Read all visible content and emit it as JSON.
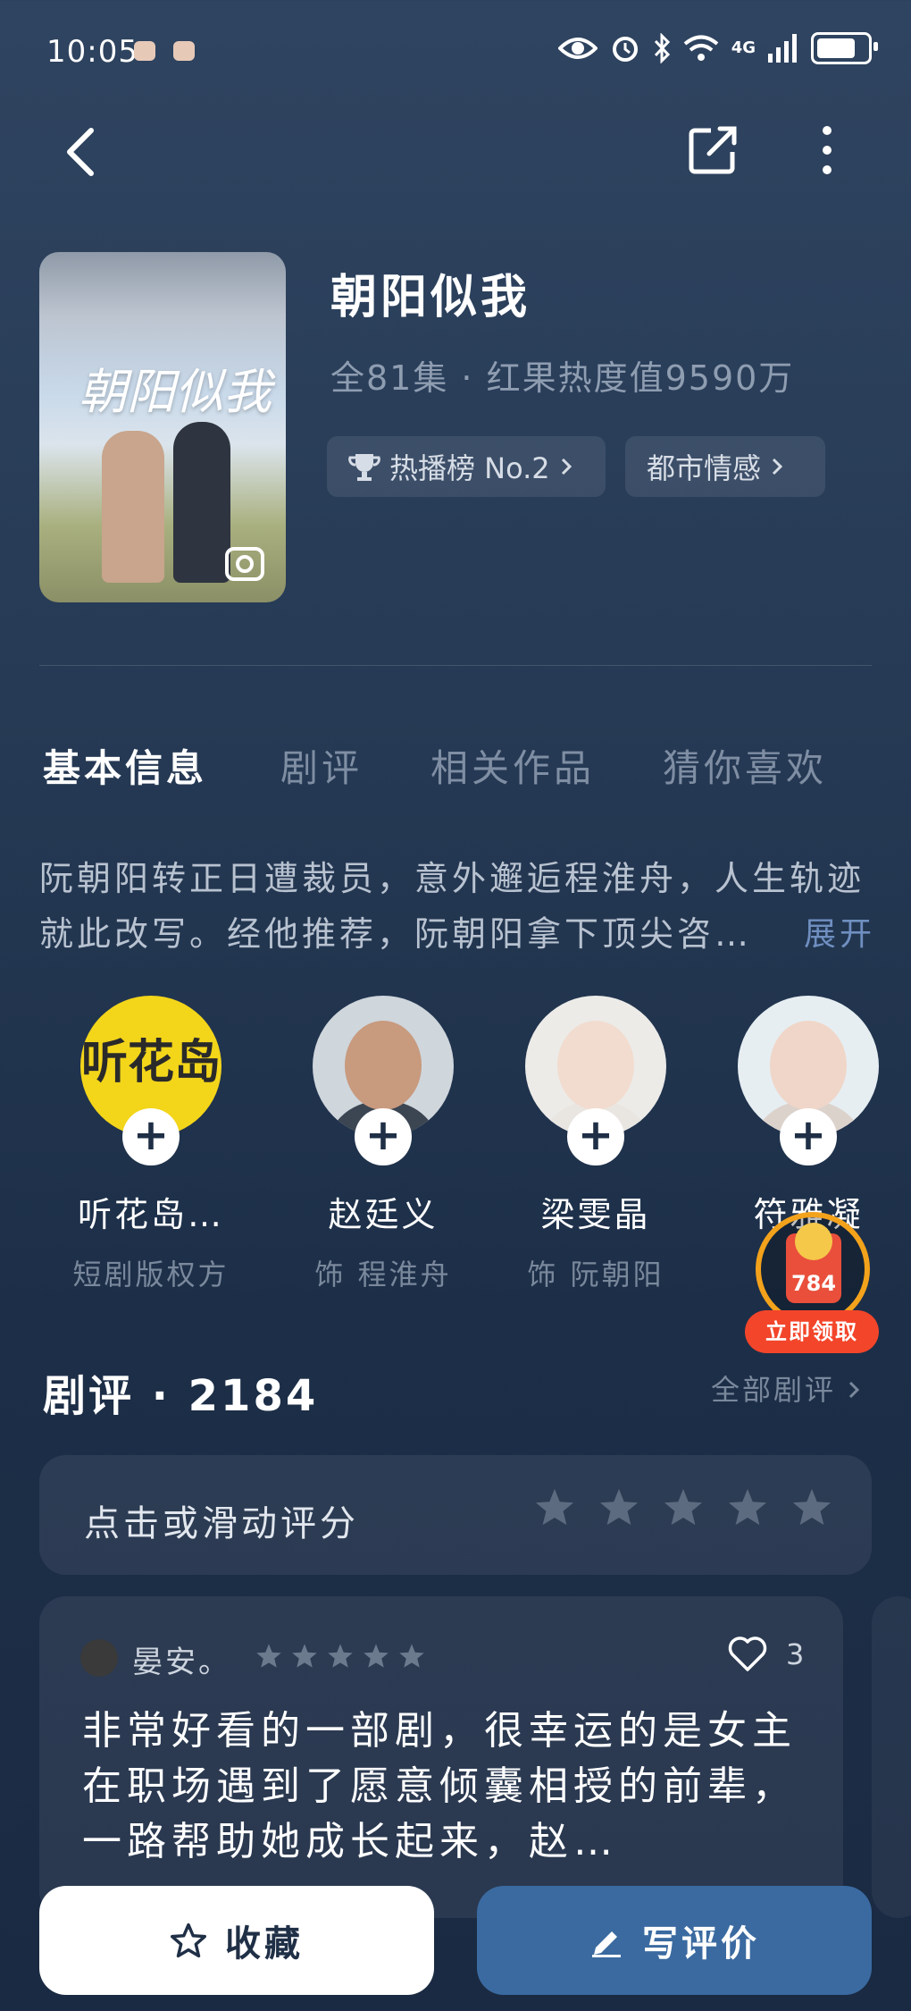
{
  "status_bar": {
    "time": "10:05",
    "network": "4G"
  },
  "show": {
    "title": "朝阳似我",
    "meta": "全81集 · 红果热度值9590万",
    "poster_title": "朝阳似我",
    "tags": [
      {
        "label": "热播榜 No.2",
        "icon": "trophy-icon"
      },
      {
        "label": "都市情感"
      }
    ]
  },
  "tabs": [
    {
      "label": "基本信息",
      "active": true
    },
    {
      "label": "剧评"
    },
    {
      "label": "相关作品"
    },
    {
      "label": "猜你喜欢"
    }
  ],
  "synopsis": {
    "text": "阮朝阳转正日遭裁员，意外邂逅程淮舟，人生轨迹就此改写。经他推荐，阮朝阳拿下顶尖咨…",
    "expand_label": "展开"
  },
  "cast": [
    {
      "name": "听花岛…",
      "role": "短剧版权方",
      "logo_text": "听花岛"
    },
    {
      "name": "赵廷义",
      "role": "饰 程淮舟"
    },
    {
      "name": "梁雯晶",
      "role": "饰 阮朝阳"
    },
    {
      "name": "符雅凝",
      "role": "饰"
    }
  ],
  "reward": {
    "amount": "784",
    "button_label": "立即领取"
  },
  "reviews": {
    "title": "剧评 · 2184",
    "all_label": "全部剧评",
    "rate_prompt": "点击或滑动评分",
    "items": [
      {
        "user": "晏安。",
        "rating": 5,
        "likes": "3",
        "text": "非常好看的一部剧，很幸运的是女主在职场遇到了愿意倾囊相授的前辈，一路帮助她成长起来，赵…"
      }
    ]
  },
  "actions": {
    "favorite_label": "收藏",
    "write_review_label": "写评价"
  },
  "colors": {
    "accent": "#3a6aa0",
    "muted": "#7a889c",
    "reward": "#f3452a"
  }
}
